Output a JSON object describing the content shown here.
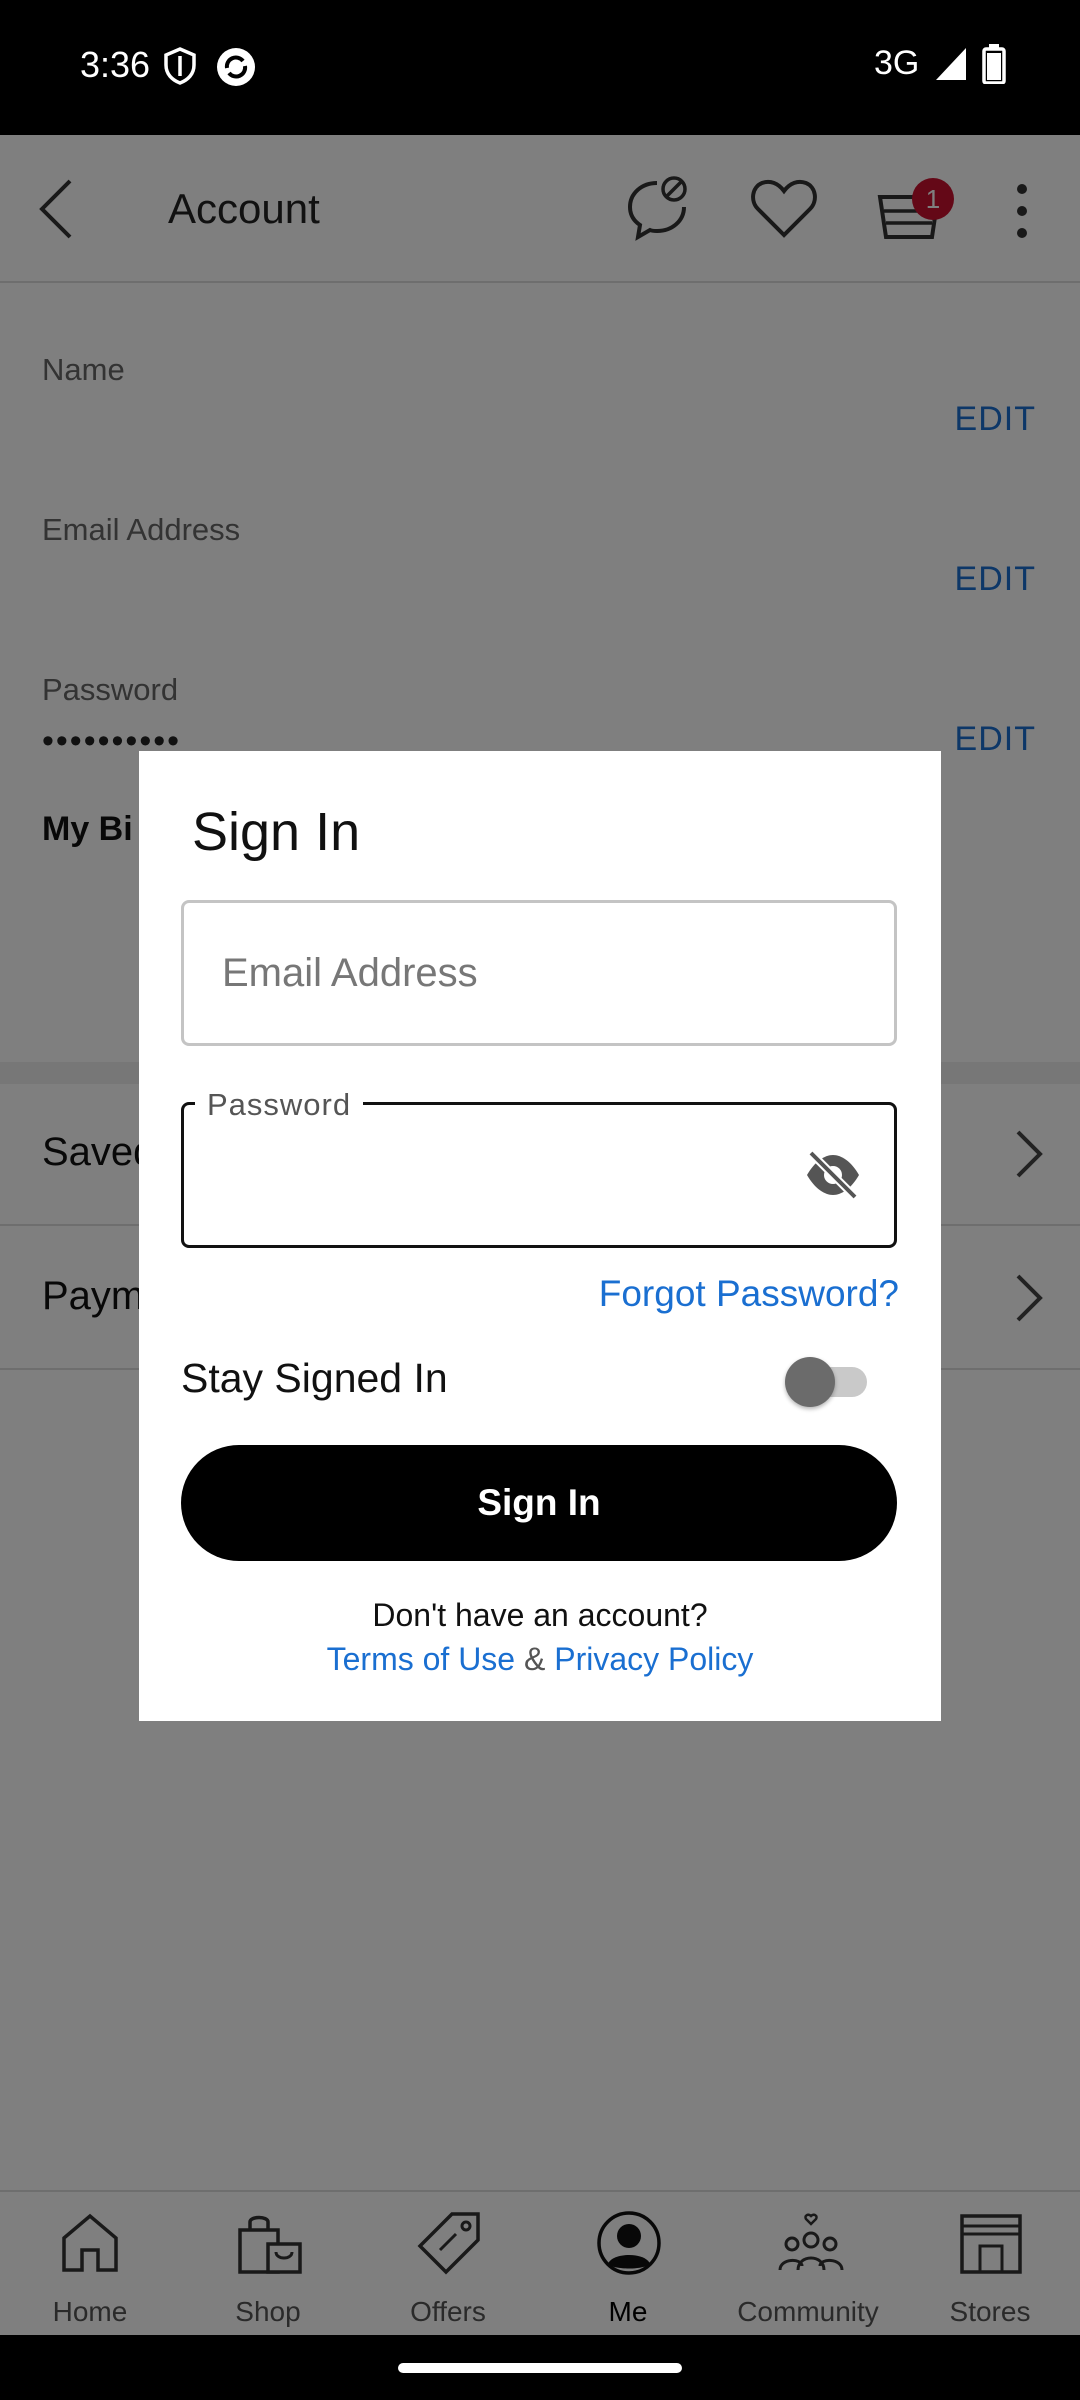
{
  "status_bar": {
    "time": "3:36",
    "network": "3G"
  },
  "app_bar": {
    "title": "Account",
    "cart_count": "1"
  },
  "account": {
    "name_label": "Name",
    "email_label": "Email Address",
    "password_label": "Password",
    "password_value": "••••••••••",
    "edit_label": "EDIT",
    "birthday_label": "My Bi"
  },
  "rows": [
    {
      "label": "Saved"
    },
    {
      "label": "Paym"
    }
  ],
  "bottom_nav": [
    {
      "label": "Home",
      "icon": "home-icon"
    },
    {
      "label": "Shop",
      "icon": "shopping-bag-icon"
    },
    {
      "label": "Offers",
      "icon": "tag-icon"
    },
    {
      "label": "Me",
      "icon": "profile-icon"
    },
    {
      "label": "Community",
      "icon": "community-icon"
    },
    {
      "label": "Stores",
      "icon": "store-icon"
    }
  ],
  "dialog": {
    "title": "Sign In",
    "email_placeholder": "Email Address",
    "password_label": "Password",
    "forgot_password": "Forgot Password?",
    "stay_signed_in": "Stay Signed In",
    "sign_in_button": "Sign In",
    "no_account": "Don't have an account?",
    "terms": "Terms of Use",
    "ampersand": "&",
    "privacy": "Privacy Policy"
  }
}
